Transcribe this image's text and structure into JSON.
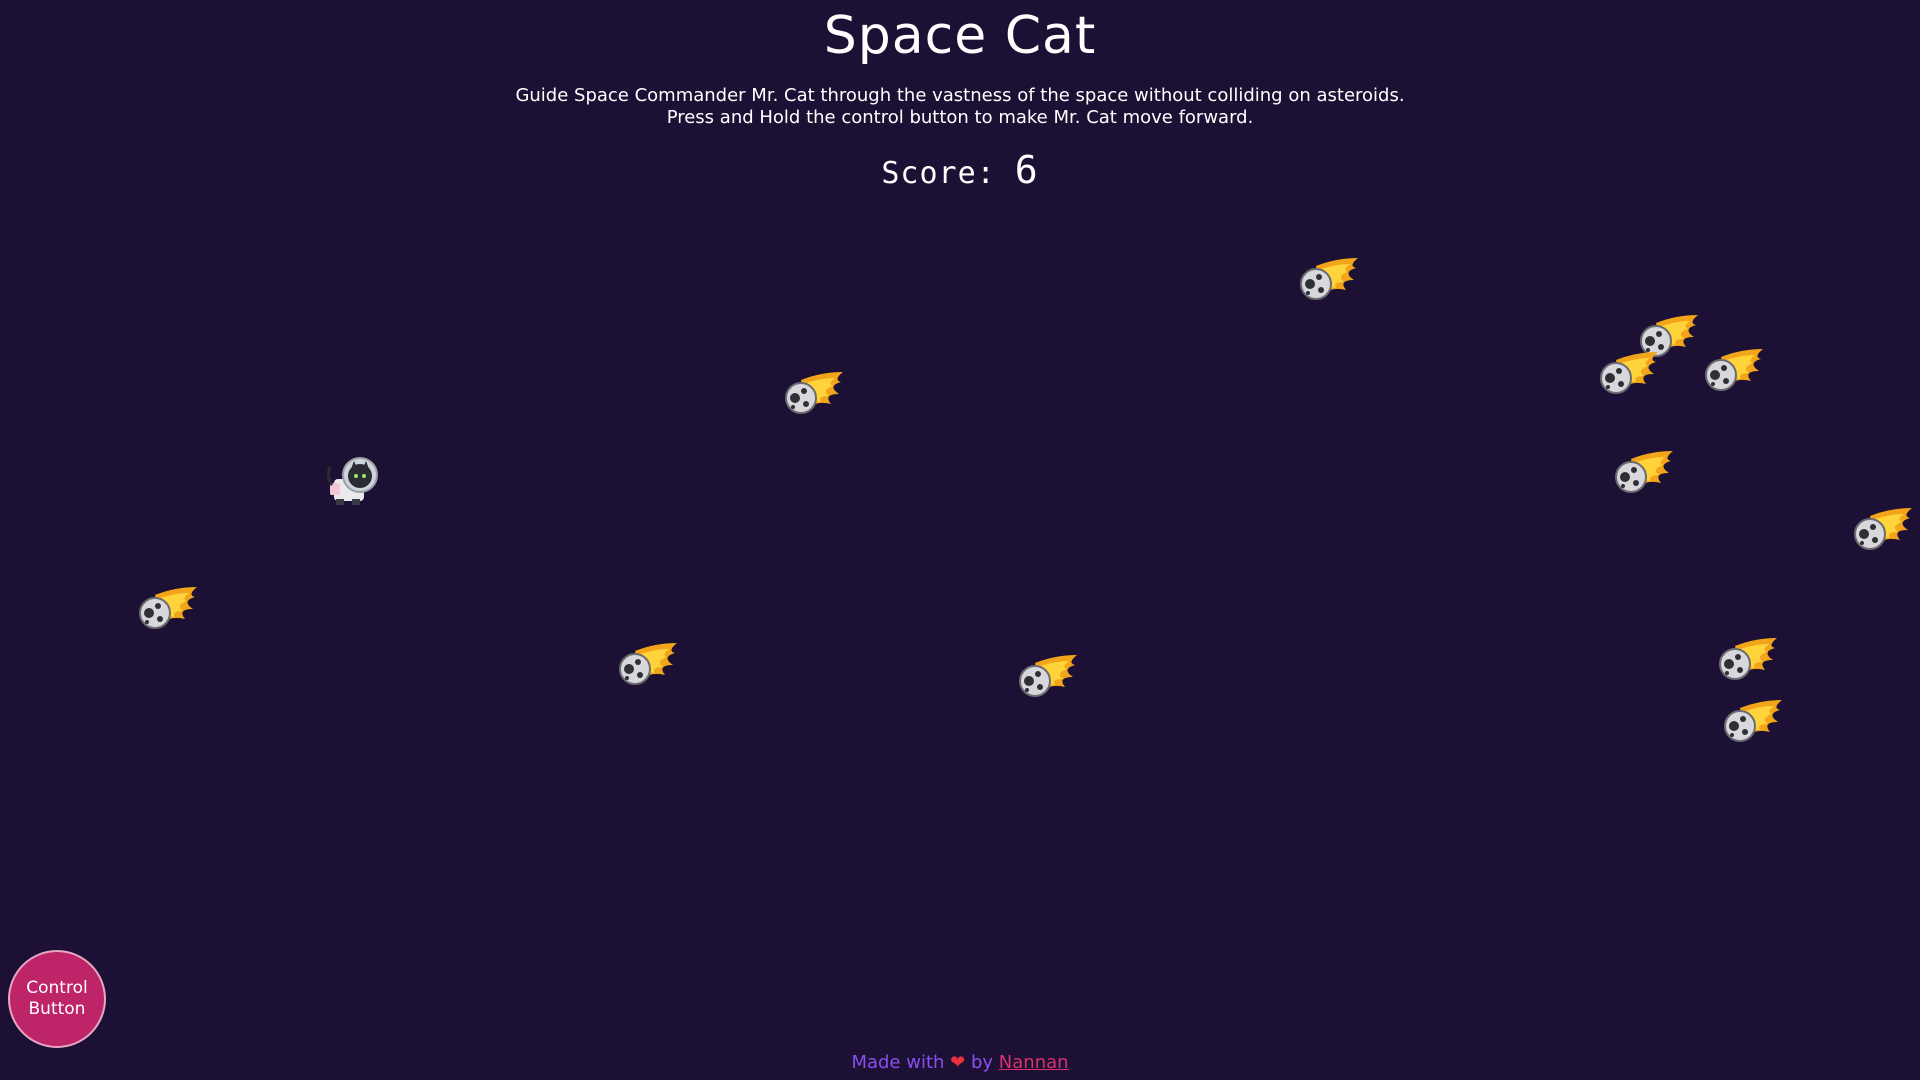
{
  "game": {
    "title": "Space Cat",
    "instructions_line1": "Guide Space Commander Mr. Cat through the vastness of the space without colliding on asteroids.",
    "instructions_line2": "Press and Hold the control button to make Mr. Cat move forward.",
    "score_label": "Score:",
    "score_value": "6"
  },
  "controls": {
    "control_button_label": "Control Button"
  },
  "footer": {
    "made_with": "Made with",
    "heart_glyph": "❤",
    "by": "by",
    "author": "Nannan"
  },
  "sprites": {
    "player": "astronaut-cat-icon",
    "obstacle": "flaming-asteroid-icon"
  },
  "colors": {
    "background": "#1c1134",
    "control_button": "#bd2568",
    "footer_text": "#8a4ff0",
    "link": "#d6336c",
    "heart": "#e8313e"
  }
}
